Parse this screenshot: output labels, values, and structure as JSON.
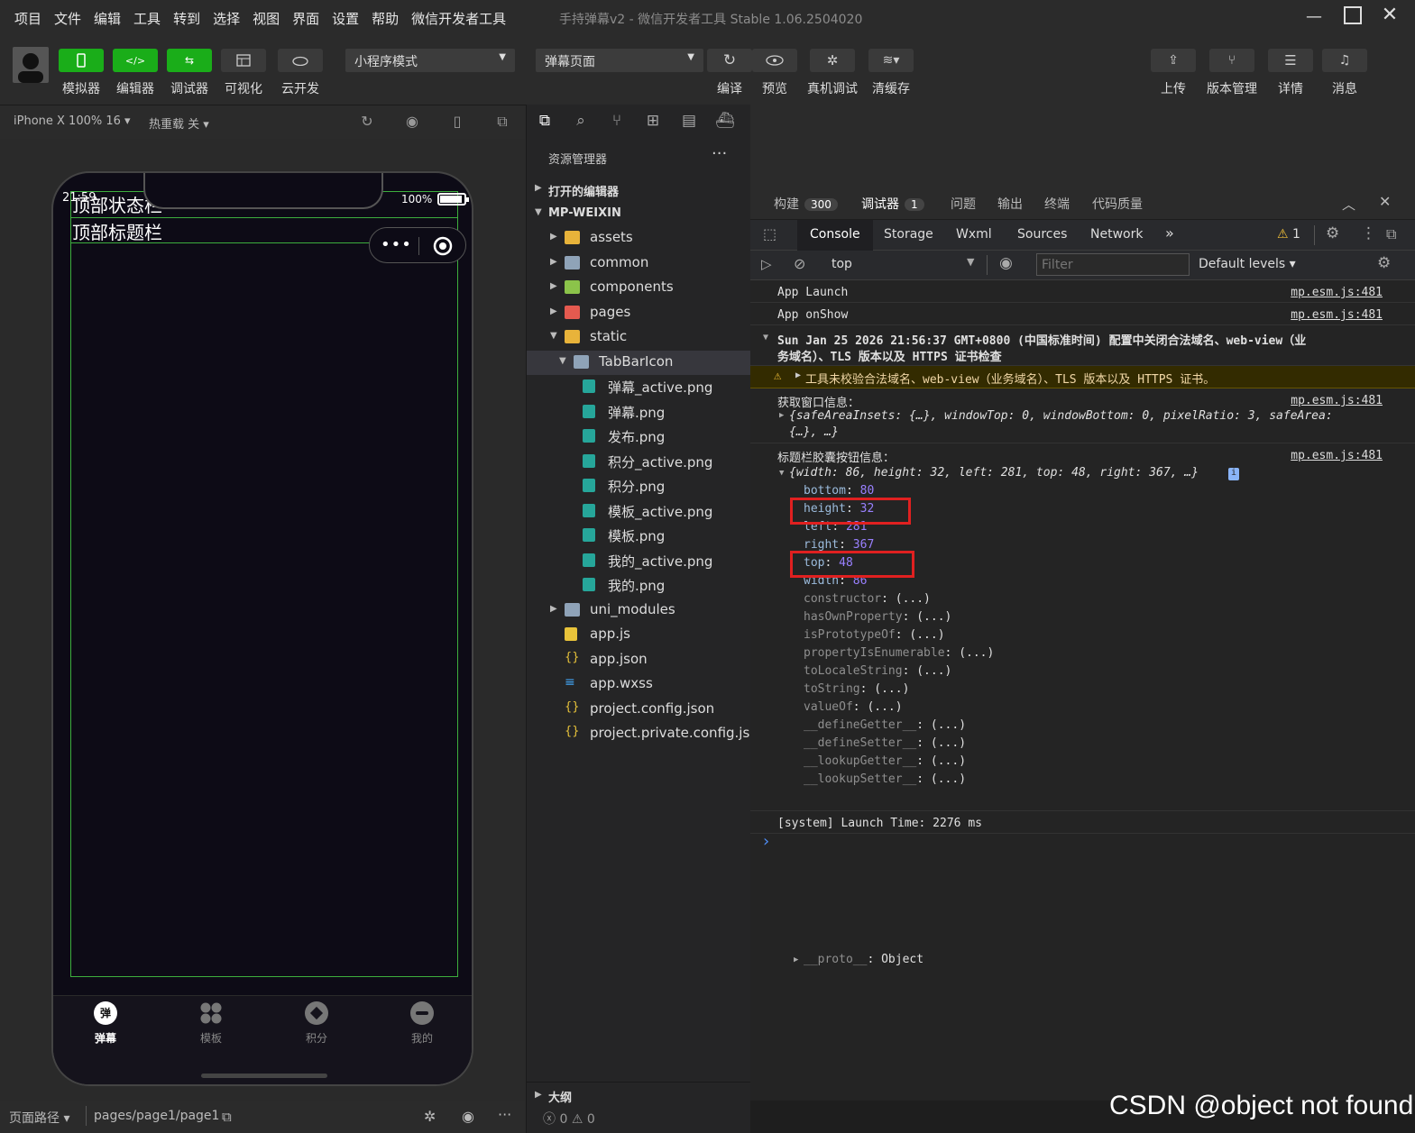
{
  "menu": [
    "项目",
    "文件",
    "编辑",
    "工具",
    "转到",
    "选择",
    "视图",
    "界面",
    "设置",
    "帮助",
    "微信开发者工具"
  ],
  "window_title": "手持弹幕v2 - 微信开发者工具 Stable 1.06.2504020",
  "toolbar": {
    "left_buttons": [
      "模拟器",
      "编辑器",
      "调试器",
      "可视化",
      "云开发"
    ],
    "mode_select": "小程序模式",
    "page_select": "弹幕页面",
    "mid_buttons": [
      "编译",
      "预览",
      "真机调试",
      "清缓存"
    ],
    "right_buttons": [
      "上传",
      "版本管理",
      "详情",
      "消息"
    ]
  },
  "sim_bar": {
    "device": "iPhone X 100% 16",
    "hotreload": "热重载 关"
  },
  "phone": {
    "time": "21:59",
    "battery": "100%",
    "status_label": "顶部状态栏",
    "title_label": "顶部标题栏",
    "tabs": [
      {
        "icon": "弹",
        "label": "弹幕"
      },
      {
        "icon": "",
        "label": "模板"
      },
      {
        "icon": "",
        "label": "积分"
      },
      {
        "icon": "",
        "label": "我的"
      }
    ]
  },
  "explorer": {
    "title": "资源管理器",
    "more": "···",
    "open_editors": "打开的编辑器",
    "root": "MP-WEIXIN",
    "items": [
      {
        "label": "assets",
        "type": "folder-yellow"
      },
      {
        "label": "common",
        "type": "folder"
      },
      {
        "label": "components",
        "type": "folder-green"
      },
      {
        "label": "pages",
        "type": "folder-red"
      },
      {
        "label": "static",
        "type": "folder-yellow-open"
      },
      {
        "label": "TabBarIcon",
        "type": "folder-open"
      },
      {
        "label": "弹幕_active.png",
        "type": "image"
      },
      {
        "label": "弹幕.png",
        "type": "image"
      },
      {
        "label": "发布.png",
        "type": "image"
      },
      {
        "label": "积分_active.png",
        "type": "image"
      },
      {
        "label": "积分.png",
        "type": "image"
      },
      {
        "label": "模板_active.png",
        "type": "image"
      },
      {
        "label": "模板.png",
        "type": "image"
      },
      {
        "label": "我的_active.png",
        "type": "image"
      },
      {
        "label": "我的.png",
        "type": "image"
      },
      {
        "label": "uni_modules",
        "type": "folder"
      },
      {
        "label": "app.js",
        "type": "js"
      },
      {
        "label": "app.json",
        "type": "json"
      },
      {
        "label": "app.wxss",
        "type": "css"
      },
      {
        "label": "project.config.json",
        "type": "json"
      },
      {
        "label": "project.private.config.js...",
        "type": "json"
      }
    ],
    "outline": "大纲"
  },
  "bottom": {
    "path_label": "页面路径",
    "path": "pages/page1/page1",
    "errors": "0",
    "warnings": "0"
  },
  "panel_tabs": [
    {
      "label": "构建",
      "badge": "300"
    },
    {
      "label": "调试器",
      "badge": "1"
    },
    {
      "label": "问题",
      "badge": ""
    },
    {
      "label": "输出",
      "badge": ""
    },
    {
      "label": "终端",
      "badge": ""
    },
    {
      "label": "代码质量",
      "badge": ""
    }
  ],
  "devtools": {
    "tabs": [
      "Console",
      "Storage",
      "Wxml",
      "Sources",
      "Network"
    ],
    "more": "»",
    "warn_count": "1",
    "context": "top",
    "filter_placeholder": "Filter",
    "levels": "Default levels"
  },
  "console": {
    "src": "mp.esm.js:481",
    "line1": "App Launch",
    "line2": "App onShow",
    "line3a": "Sun Jan 25 2026 21:56:37 GMT+0800 (中国标准时间) 配置中关闭合法域名、web-view（业",
    "line3b": "务域名）、TLS 版本以及 HTTPS 证书检查",
    "warn": "工具未校验合法域名、web-view（业务域名）、TLS 版本以及 HTTPS 证书。",
    "window_info_label": "获取窗口信息：",
    "window_info_obj_a": "{safeAreaInsets: {…}, windowTop: 0, windowBottom: 0, pixelRatio: 3, safeArea:",
    "window_info_obj_b": "{…}, …}",
    "capsule_label": "标题栏胶囊按钮信息：",
    "capsule_obj": "{width: 86, height: 32, left: 281, top: 48, right: 367, …}",
    "props": [
      {
        "k": "bottom",
        "v": "80"
      },
      {
        "k": "height",
        "v": "32"
      },
      {
        "k": "left",
        "v": "281"
      },
      {
        "k": "right",
        "v": "367"
      },
      {
        "k": "top",
        "v": "48"
      },
      {
        "k": "width",
        "v": "86"
      }
    ],
    "methods": [
      "constructor",
      "hasOwnProperty",
      "isPrototypeOf",
      "propertyIsEnumerable",
      "toLocaleString",
      "toString",
      "valueOf",
      "__defineGetter__",
      "__defineSetter__",
      "__lookupGetter__",
      "__lookupSetter__"
    ],
    "method_value": "(...)",
    "proto": "__proto__",
    "proto_value": "Object",
    "launch_time": "[system] Launch Time: 2276 ms",
    "prompt": "›"
  },
  "watermark": "CSDN @object not found"
}
